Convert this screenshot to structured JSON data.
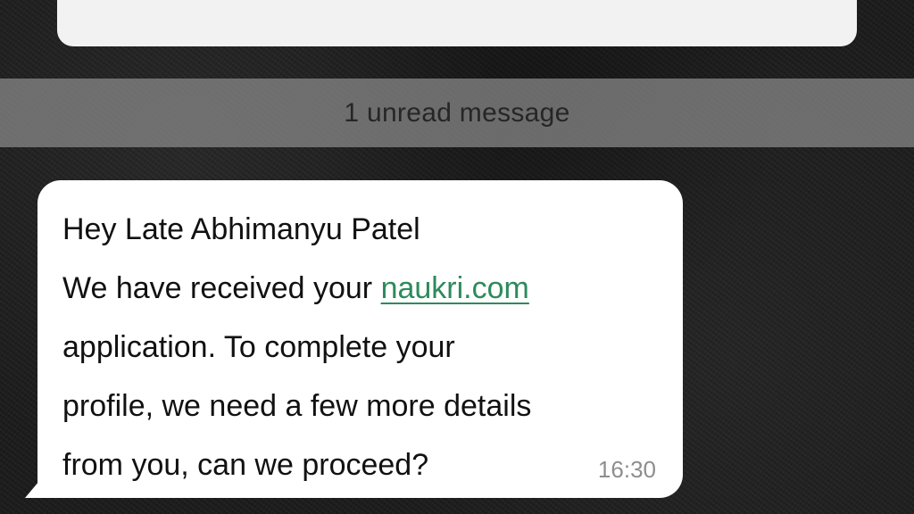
{
  "banner": {
    "unread_label": "1 unread message"
  },
  "message": {
    "line1": "Hey Late Abhimanyu Patel",
    "line2_prefix": "We have received your ",
    "link_text": "naukri.com",
    "line3": "application. To complete your",
    "line4": "profile, we need a few more details",
    "line5": "from you, can we proceed?",
    "time": "16:30"
  },
  "colors": {
    "link": "#2d8a5c",
    "bubble": "#ffffff",
    "banner": "#8c8c8c",
    "timestamp": "#8e8e8e"
  }
}
